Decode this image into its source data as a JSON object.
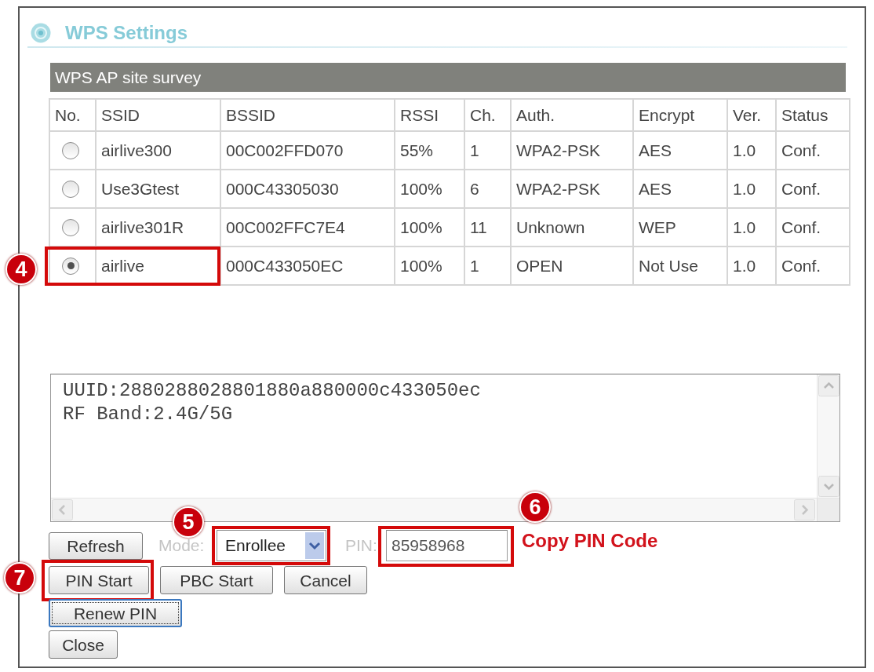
{
  "title": "WPS Settings",
  "survey": {
    "title": "WPS AP site survey",
    "columns": [
      "No.",
      "SSID",
      "BSSID",
      "RSSI",
      "Ch.",
      "Auth.",
      "Encrypt",
      "Ver.",
      "Status"
    ],
    "rows": [
      {
        "selected": false,
        "cells": [
          "",
          "airlive300",
          "00C002FFD070",
          "55%",
          "1",
          "WPA2-PSK",
          "AES",
          "1.0",
          "Conf."
        ]
      },
      {
        "selected": false,
        "cells": [
          "",
          "Use3Gtest",
          "000C43305030",
          "100%",
          "6",
          "WPA2-PSK",
          "AES",
          "1.0",
          "Conf."
        ]
      },
      {
        "selected": false,
        "cells": [
          "",
          "airlive301R",
          "00C002FFC7E4",
          "100%",
          "11",
          "Unknown",
          "WEP",
          "1.0",
          "Conf."
        ]
      },
      {
        "selected": true,
        "callout": "4",
        "cells": [
          "",
          "airlive",
          "000C433050EC",
          "100%",
          "1",
          "OPEN",
          "Not Use",
          "1.0",
          "Conf."
        ]
      }
    ]
  },
  "details": {
    "lines": [
      "UUID:2880288028801880a880000c433050ec",
      "RF Band:2.4G/5G"
    ]
  },
  "controls": {
    "refresh": {
      "label": "Refresh",
      "focused": false
    },
    "mode": {
      "label": "Mode:",
      "disabled": true,
      "value": "Enrollee",
      "callout": "5"
    },
    "pin": {
      "label": "PIN:",
      "disabled": true,
      "value": "85958968",
      "callout": "6",
      "note": "Copy PIN Code"
    }
  },
  "button_rows": [
    [
      {
        "label": "PIN Start",
        "focused": false,
        "callout": "7"
      },
      {
        "label": "PBC Start",
        "focused": false
      },
      {
        "label": "Cancel",
        "focused": false
      }
    ],
    [
      {
        "label": "Renew PIN",
        "focused": true
      }
    ],
    [
      {
        "label": "Close",
        "focused": false
      }
    ]
  ]
}
